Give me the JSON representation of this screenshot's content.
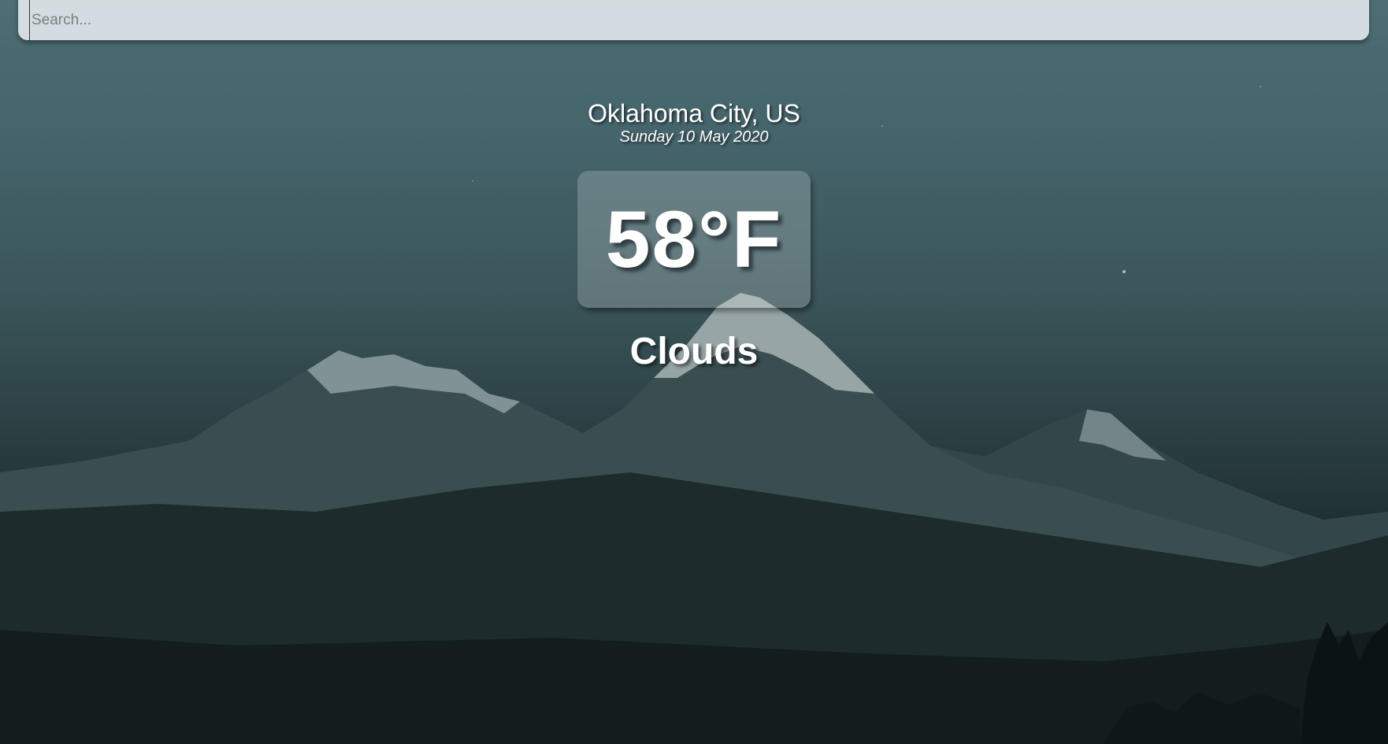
{
  "search": {
    "placeholder": "Search...",
    "value": ""
  },
  "weather": {
    "location": "Oklahoma City, US",
    "date": "Sunday 10 May 2020",
    "temperature": "58°F",
    "condition": "Clouds"
  },
  "background": {
    "scene": "mountain-landscape-at-dusk",
    "sky_color": "#4d6e74",
    "ground_color": "#121c1d"
  }
}
